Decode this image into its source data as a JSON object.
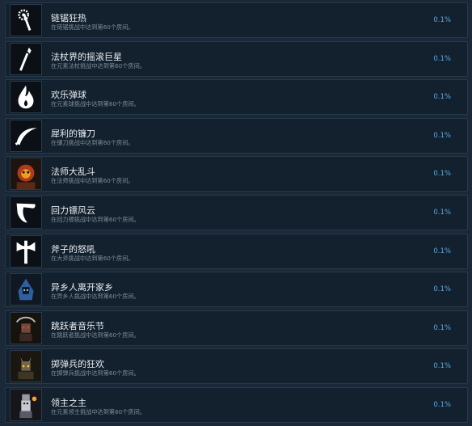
{
  "achievements": [
    {
      "title": "链锯狂热",
      "desc": "在链锯挑战中达到第60个房间。",
      "pct": "0.1%",
      "icon": "chainsaw-icon"
    },
    {
      "title": "法杖界的摇滚巨星",
      "desc": "在元素法杖挑战中达到第60个房间。",
      "pct": "0.1%",
      "icon": "staff-icon"
    },
    {
      "title": "欢乐弹球",
      "desc": "在元素球挑战中达到第60个房间。",
      "pct": "0.1%",
      "icon": "flame-icon"
    },
    {
      "title": "犀利的镰刀",
      "desc": "在镰刀挑战中达到第60个房间。",
      "pct": "0.1%",
      "icon": "sickle-icon"
    },
    {
      "title": "法师大乱斗",
      "desc": "在法师挑战中达到第60个房间。",
      "pct": "0.1%",
      "icon": "mage-portrait-icon"
    },
    {
      "title": "回力镖风云",
      "desc": "在回力镖挑战中达到第60个房间。",
      "pct": "0.1%",
      "icon": "boomerang-icon"
    },
    {
      "title": "斧子的怒吼",
      "desc": "在大斧挑战中达到第60个房间。",
      "pct": "0.1%",
      "icon": "axe-icon"
    },
    {
      "title": "异乡人离开家乡",
      "desc": "在异乡人挑战中达到第60个房间。",
      "pct": "0.1%",
      "icon": "stranger-portrait-icon"
    },
    {
      "title": "跳跃者音乐节",
      "desc": "在跳跃者挑战中达到第60个房间。",
      "pct": "0.1%",
      "icon": "jumper-portrait-icon"
    },
    {
      "title": "掷弹兵的狂欢",
      "desc": "在掷弹兵挑战中达到第60个房间。",
      "pct": "0.1%",
      "icon": "grenadier-portrait-icon"
    },
    {
      "title": "领主之主",
      "desc": "在元素领主挑战中达到第60个房间。",
      "pct": "0.1%",
      "icon": "lord-portrait-icon"
    }
  ]
}
